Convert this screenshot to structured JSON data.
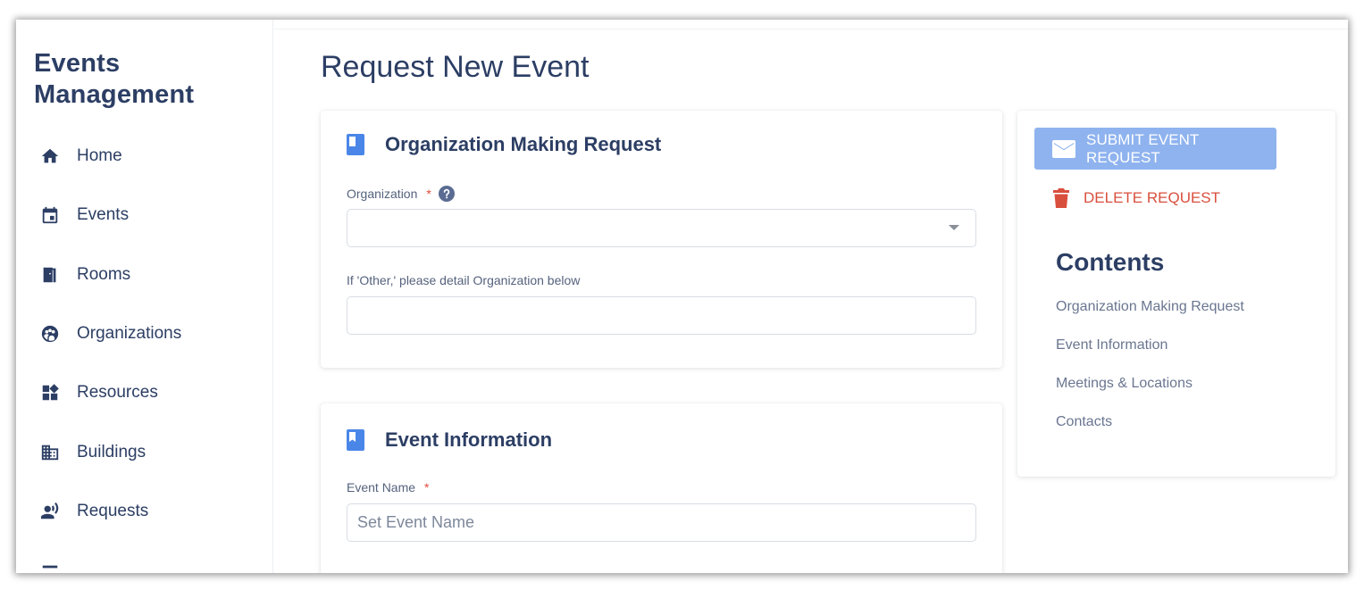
{
  "sidebar": {
    "brand_line1": "Events",
    "brand_line2": "Management",
    "items": [
      {
        "label": "Home",
        "icon": "home-icon"
      },
      {
        "label": "Events",
        "icon": "calendar-icon"
      },
      {
        "label": "Rooms",
        "icon": "door-icon"
      },
      {
        "label": "Organizations",
        "icon": "group-icon"
      },
      {
        "label": "Resources",
        "icon": "widgets-icon"
      },
      {
        "label": "Buildings",
        "icon": "building-icon"
      },
      {
        "label": "Requests",
        "icon": "record-voice-icon"
      }
    ]
  },
  "main": {
    "title": "Request New Event",
    "org_section": {
      "title": "Organization Making Request",
      "organization_label": "Organization",
      "required_mark": "*",
      "organization_value": "",
      "other_label": "If 'Other,' please detail Organization below",
      "other_value": ""
    },
    "event_section": {
      "title": "Event Information",
      "event_name_label": "Event Name",
      "required_mark": "*",
      "event_name_value": "",
      "event_name_placeholder": "Set Event Name"
    }
  },
  "actions": {
    "submit_label": "SUBMIT EVENT REQUEST",
    "delete_label": "DELETE REQUEST"
  },
  "contents": {
    "title": "Contents",
    "links": [
      "Organization Making Request",
      "Event Information",
      "Meetings & Locations",
      "Contacts"
    ]
  },
  "colors": {
    "text_primary": "#2c3e64",
    "accent_blue": "#4a86e8",
    "submit_button": "#8fb3ef",
    "danger": "#d94f3d",
    "help_icon": "#5b6c93"
  }
}
